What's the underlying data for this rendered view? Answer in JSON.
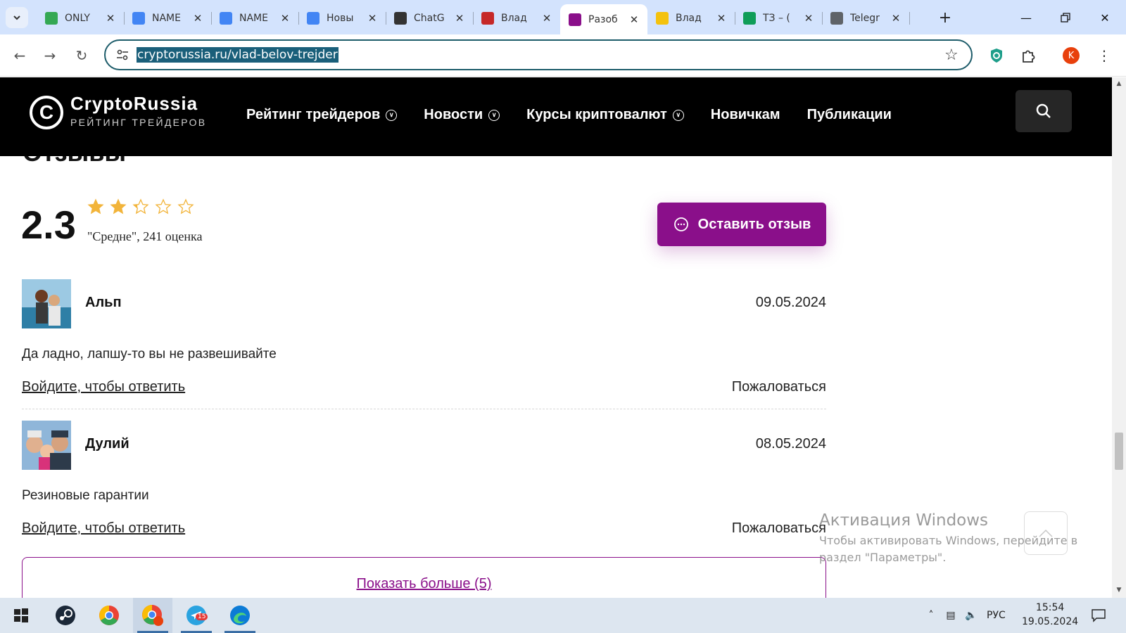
{
  "browser": {
    "tabs": [
      {
        "label": "ONLY",
        "favicon": "drive-icon",
        "color": "#34a853"
      },
      {
        "label": "NAME",
        "favicon": "docs-icon",
        "color": "#4285f4"
      },
      {
        "label": "NAME",
        "favicon": "docs-icon",
        "color": "#4285f4"
      },
      {
        "label": "Новы",
        "favicon": "docs-icon",
        "color": "#4285f4"
      },
      {
        "label": "ChatG",
        "favicon": "chatgpt-icon",
        "color": "#333333"
      },
      {
        "label": "Влад",
        "favicon": "pen-icon",
        "color": "#c62828"
      },
      {
        "label": "Разоб",
        "favicon": "cryptorussia-icon",
        "color": "#8a0f8a",
        "active": true
      },
      {
        "label": "Влад",
        "favicon": "star-icon",
        "color": "#f4c20d"
      },
      {
        "label": "ТЗ – (",
        "favicon": "sheets-icon",
        "color": "#0f9d58"
      },
      {
        "label": "Telegr",
        "favicon": "globe-icon",
        "color": "#5f6368"
      }
    ],
    "url": "cryptorussia.ru/vlad-belov-trejder",
    "profile_initial": "K"
  },
  "site": {
    "logo_title": "CryptoRussia",
    "logo_subtitle": "РЕЙТИНГ ТРЕЙДЕРОВ",
    "nav": [
      {
        "label": "Рейтинг трейдеров",
        "dropdown": true
      },
      {
        "label": "Новости",
        "dropdown": true
      },
      {
        "label": "Курсы криптовалют",
        "dropdown": true
      },
      {
        "label": "Новичкам",
        "dropdown": false
      },
      {
        "label": "Публикации",
        "dropdown": false
      }
    ],
    "brand_color": "#8a0f8a"
  },
  "reviews_section": {
    "title": "Отзывы",
    "rating": "2.3",
    "rating_fraction": 0.46,
    "stars_filled": 2.3,
    "stars_total": 5,
    "caption": "\"Средне\", 241 оценка",
    "leave_review_label": "Оставить отзыв",
    "reviews": [
      {
        "name": "Альп",
        "date": "09.05.2024",
        "text": "Да ладно, лапшу-то вы не развешивайте",
        "reply_label": "Войдите, чтобы ответить",
        "report_label": "Пожаловаться"
      },
      {
        "name": "Дулий",
        "date": "08.05.2024",
        "text": "Резиновые гарантии",
        "reply_label": "Войдите, чтобы ответить",
        "report_label": "Пожаловаться"
      }
    ],
    "show_more_label": "Показать больше (5)"
  },
  "windows_activation": {
    "title": "Активация Windows",
    "message": "Чтобы активировать Windows, перейдите в раздел \"Параметры\"."
  },
  "taskbar": {
    "apps": [
      "start-icon",
      "steam-icon",
      "chrome-icon",
      "chrome-profile-icon",
      "telegram-icon",
      "edge-icon"
    ],
    "telegram_badge": "15",
    "language": "РУС",
    "time": "15:54",
    "date": "19.05.2024"
  }
}
